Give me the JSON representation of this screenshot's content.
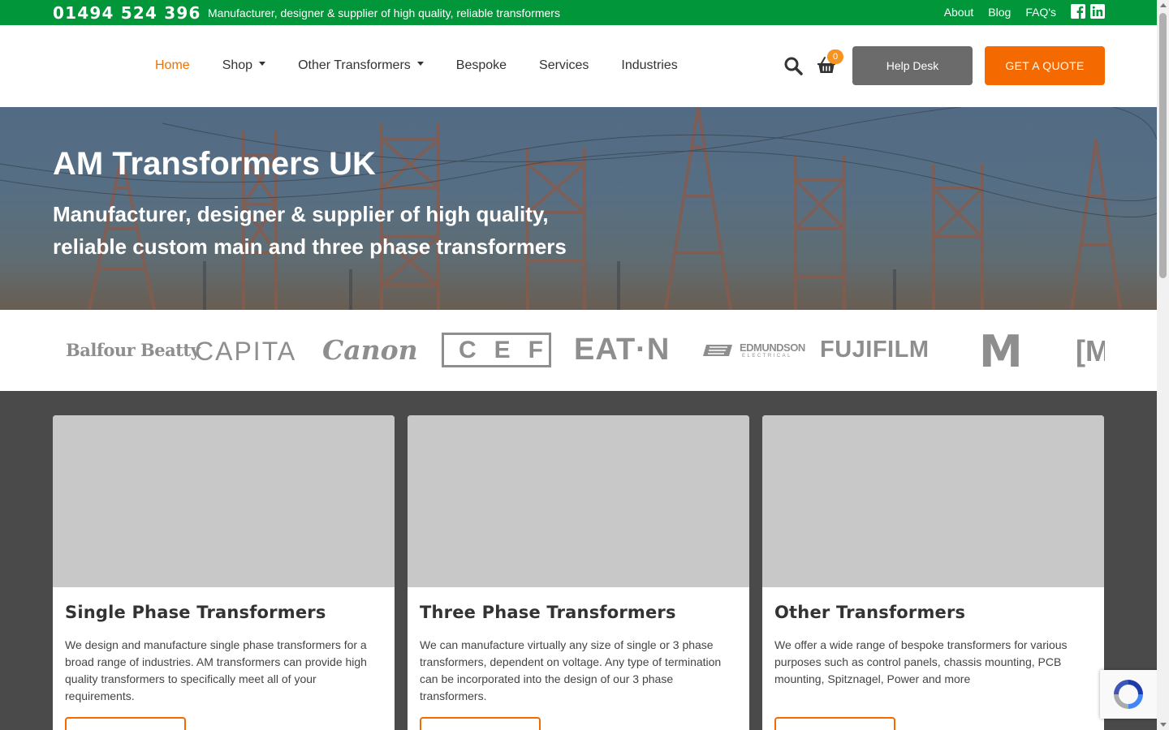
{
  "topbar": {
    "phone": "01494 524 396",
    "tagline": "Manufacturer, designer & supplier of high quality, reliable transformers",
    "links": [
      "About",
      "Blog",
      "FAQ's"
    ],
    "social": {
      "facebook_icon": "facebook-icon",
      "linkedin_icon": "linkedin-icon"
    }
  },
  "nav": {
    "items": [
      {
        "label": "Home"
      },
      {
        "label": "Shop"
      },
      {
        "label": "Other Transformers"
      },
      {
        "label": "Bespoke"
      },
      {
        "label": "Services"
      },
      {
        "label": "Industries"
      }
    ],
    "cart_count": "0",
    "help_label": "Help Desk",
    "quote_label": "GET A QUOTE"
  },
  "hero": {
    "title": "AM Transformers UK",
    "subtitle": "Manufacturer, designer & supplier of high quality, reliable custom main and three phase transformers"
  },
  "logos": [
    "Balfour Beatty",
    "CAPITA",
    "Canon",
    "CEF",
    "EAT·N",
    "EDMUNDSON",
    "ELECTRICAL",
    "FUJIFILM",
    "M",
    "[M"
  ],
  "cards": [
    {
      "title": "Single Phase Transformers",
      "desc": "We design and manufacture single phase transformers for a broad range of industries. AM transformers can provide high quality transformers to specifically meet all of your requirements."
    },
    {
      "title": "Three Phase Transformers",
      "desc": "We can manufacture virtually any size of single or 3 phase transformers, dependent on voltage. Any type of termination can be incorporated into the design of our 3 phase transformers."
    },
    {
      "title": "Other Transformers",
      "desc": "We offer a wide range of bespoke transformers for various purposes such as control panels, chassis mounting, PCB mounting, Spitznagel, Power and more"
    }
  ],
  "colors": {
    "topbar": "#009639",
    "accent": "#f56a00",
    "help": "#6b6b6b"
  }
}
